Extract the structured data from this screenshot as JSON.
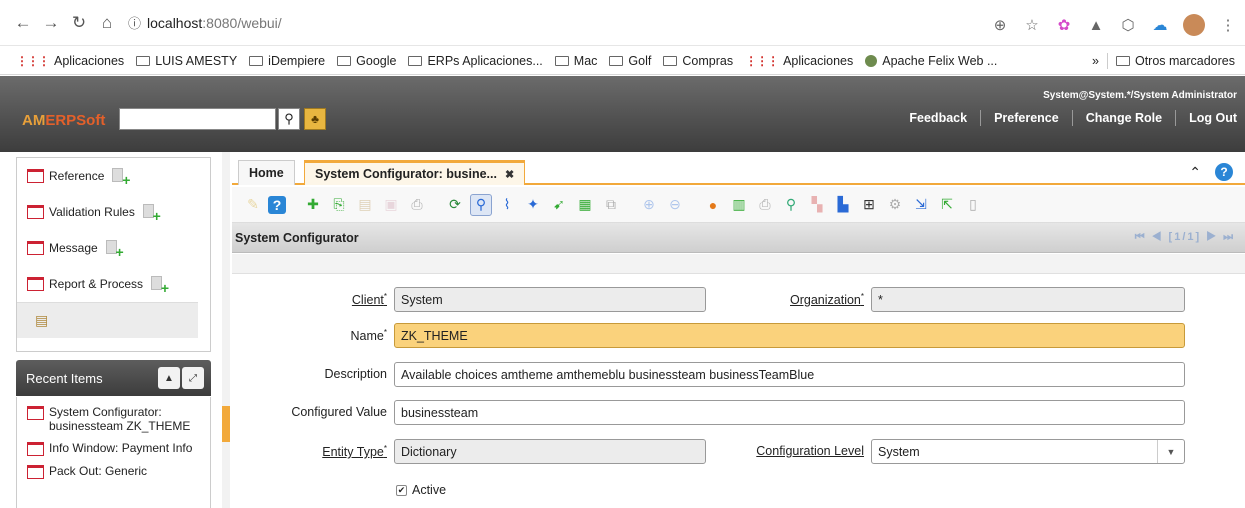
{
  "browser": {
    "url_host": "localhost",
    "url_path": ":8080/webui/",
    "bookmarks": [
      "Aplicaciones",
      "LUIS AMESTY",
      "iDempiere",
      "Google",
      "ERPs Aplicaciones...",
      "Mac",
      "Golf",
      "Compras",
      "Aplicaciones",
      "Apache Felix Web ..."
    ],
    "more": "»",
    "other_bookmarks": "Otros marcadores"
  },
  "header": {
    "logo_am": "AM",
    "logo_rest": "ERPSoft",
    "user": "System@System.*/System Administrator",
    "links": [
      "Feedback",
      "Preference",
      "Change Role",
      "Log Out"
    ]
  },
  "left_panel": {
    "items": [
      {
        "label": "Reference"
      },
      {
        "label": "Validation Rules"
      },
      {
        "label": "Message"
      },
      {
        "label": "Report & Process"
      }
    ]
  },
  "recent": {
    "title": "Recent Items",
    "items": [
      "System Configurator: businessteam ZK_THEME",
      "Info Window: Payment Info",
      "Pack Out: Generic"
    ]
  },
  "tabs": [
    {
      "label": "Home"
    },
    {
      "label": "System Configurator: busine..."
    }
  ],
  "section": {
    "title": "System Configurator",
    "record_nav": "[1/1]"
  },
  "form": {
    "client_label": "Client",
    "client_value": "System",
    "org_label": "Organization",
    "org_value": "*",
    "name_label": "Name",
    "name_value": "ZK_THEME",
    "description_label": "Description",
    "description_value": "Available choices amtheme amthemeblu businessteam businessTeamBlue",
    "configured_label": "Configured Value",
    "configured_value": "businessteam",
    "entity_label": "Entity Type",
    "entity_value": "Dictionary",
    "config_level_label": "Configuration Level",
    "config_level_value": "System",
    "active_label": "Active",
    "required_mark": "*",
    "active_checked": true
  },
  "colors": {
    "accent": "#f2a93b",
    "logo": "#e4602a",
    "name_field_bg": "#fad27c"
  }
}
